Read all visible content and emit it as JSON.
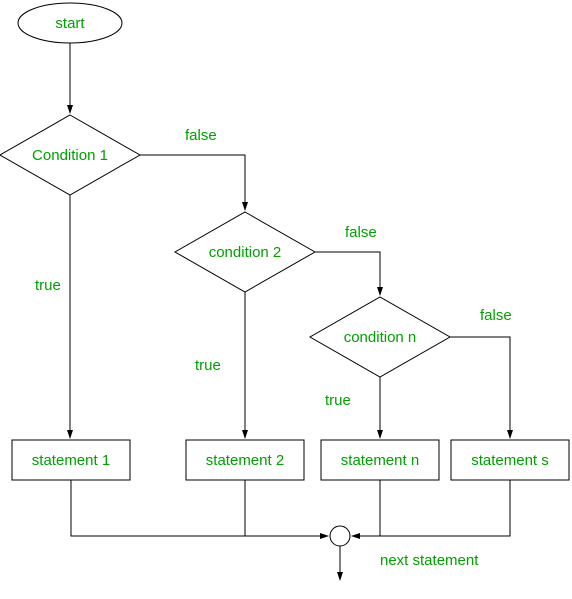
{
  "flowchart": {
    "start": "start",
    "cond1": "Condition 1",
    "cond2": "condition 2",
    "condn": "condition n",
    "stmt1": "statement 1",
    "stmt2": "statement 2",
    "stmtn": "statement n",
    "stmts": "statement s",
    "next": "next statement",
    "true": "true",
    "false": "false"
  }
}
